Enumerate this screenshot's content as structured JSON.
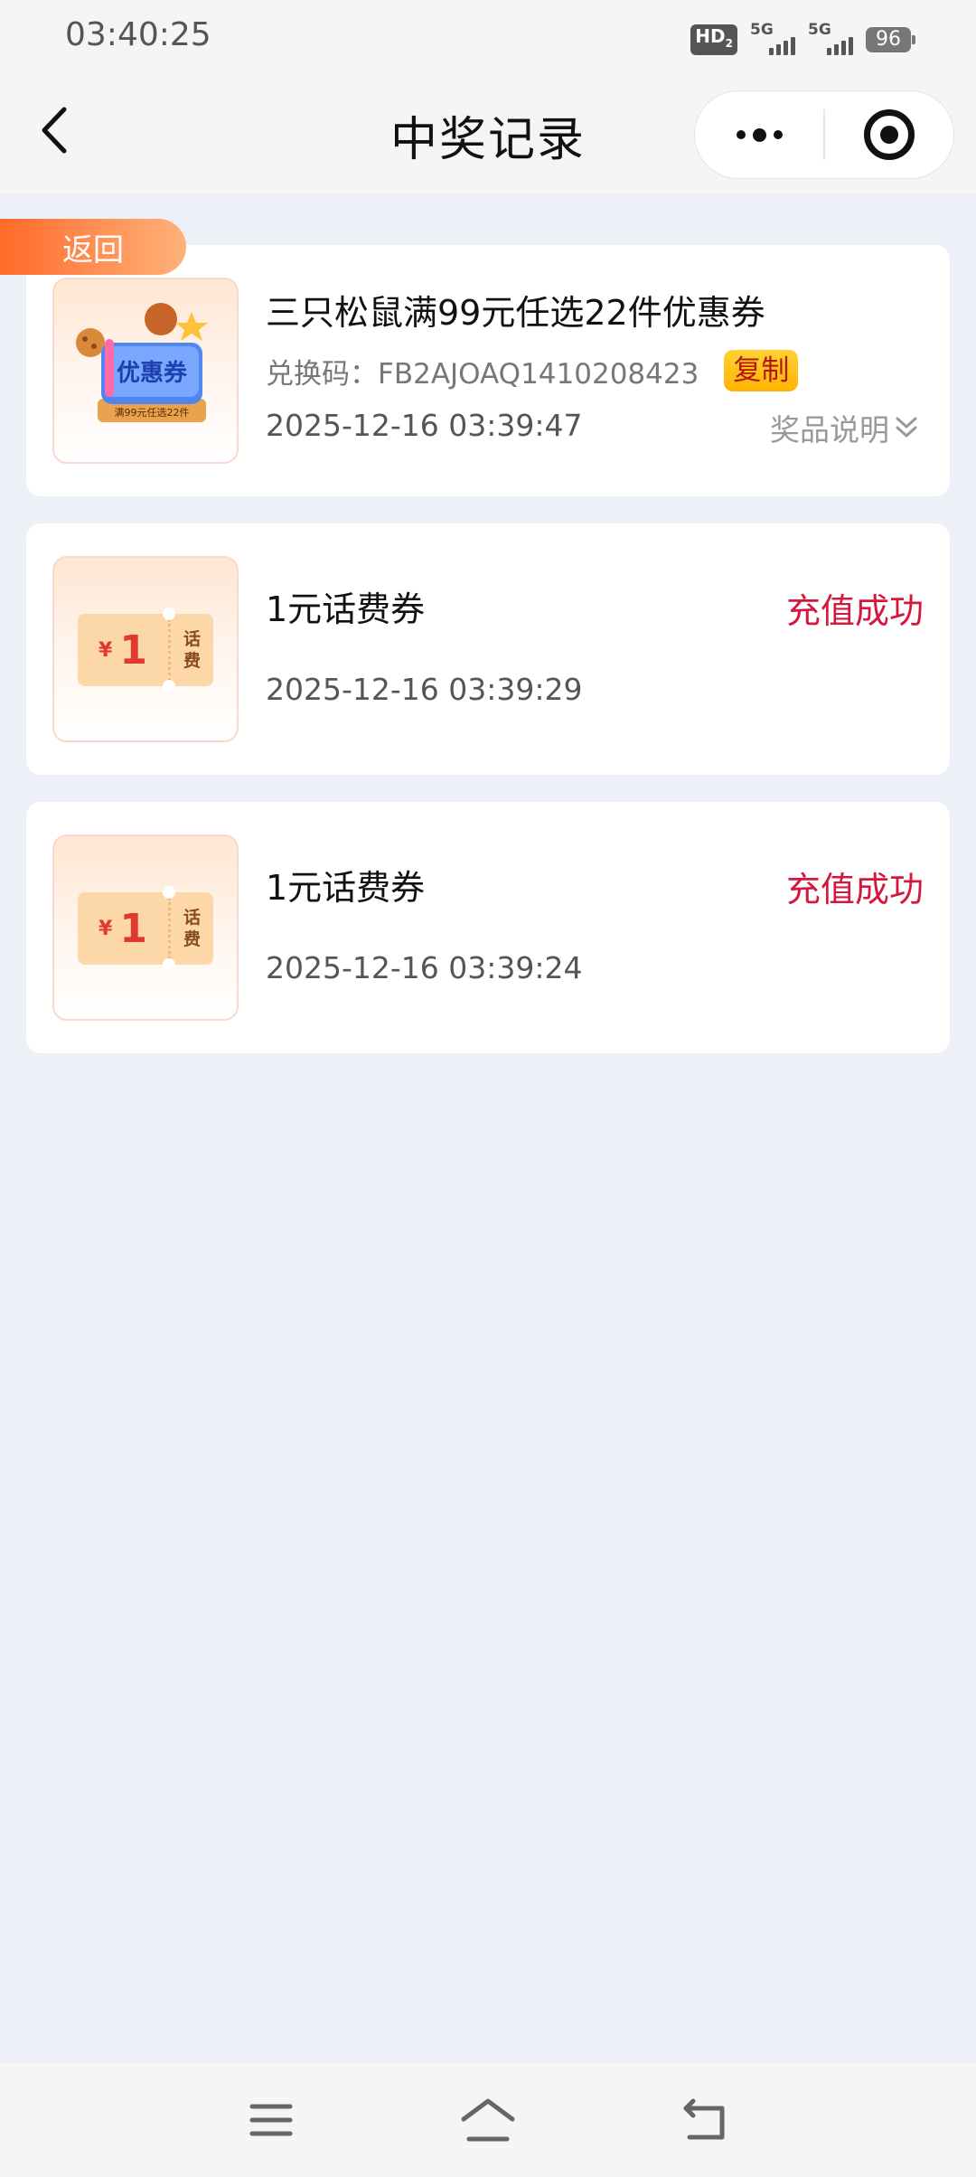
{
  "status_bar": {
    "time": "03:40:25",
    "hd_label": "HD",
    "hd_sub": "2",
    "signal1_label": "5G",
    "signal2_label": "5G",
    "battery": "96"
  },
  "nav": {
    "title": "中奖记录",
    "back_icon": "chevron-left-icon",
    "more_icon": "more-dots-icon",
    "close_icon": "target-circle-icon"
  },
  "return_tab": {
    "label": "返回"
  },
  "records": [
    {
      "name": "三只松鼠满99元任选22件优惠券",
      "code": "兑换码：FB2AJOAQ1410208423",
      "copy_label": "复制",
      "date": "2025-12-16 03:39:47",
      "desc_label": "奖品说明",
      "thumb_badge": "优惠券",
      "thumb_caption": "满99元任选22件"
    },
    {
      "name": "1元话费券",
      "status": "充值成功",
      "date": "2025-12-16 03:39:29",
      "ticket_yen": "¥",
      "ticket_amount": "1",
      "ticket_label_1": "话",
      "ticket_label_2": "费"
    },
    {
      "name": "1元话费券",
      "status": "充值成功",
      "date": "2025-12-16 03:39:24",
      "ticket_yen": "¥",
      "ticket_amount": "1",
      "ticket_label_1": "话",
      "ticket_label_2": "费"
    }
  ],
  "system_nav": {
    "menu_icon": "menu-icon",
    "home_icon": "home-icon",
    "back_icon": "back-icon"
  },
  "colors": {
    "page_bg": "#eef0f7",
    "status_red": "#d4173d",
    "copy_yellow": "#ffc107",
    "return_orange": "#ff6a2a"
  }
}
